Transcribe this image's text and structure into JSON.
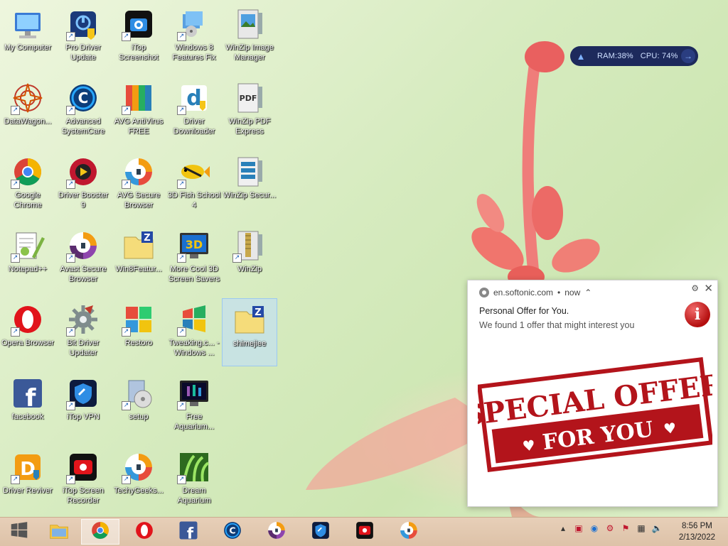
{
  "desktop": {
    "icons": [
      {
        "id": "my-computer",
        "label": "My Computer",
        "icon": "computer-icon",
        "shortcut": false
      },
      {
        "id": "pro-driver-update",
        "label": "Pro Driver Update",
        "icon": "pro-driver-update-icon",
        "shortcut": true
      },
      {
        "id": "itop-screenshot",
        "label": "iTop Screenshot",
        "icon": "camera-icon",
        "shortcut": true
      },
      {
        "id": "windows8-features-fix",
        "label": "Windows 8 Features Fix",
        "icon": "installer-icon",
        "shortcut": true
      },
      {
        "id": "winzip-image-manager",
        "label": "WinZip Image Manager",
        "icon": "winzip-image-icon",
        "shortcut": false
      },
      {
        "id": "datawagon",
        "label": "DataWagon...",
        "icon": "mandala-icon",
        "shortcut": true
      },
      {
        "id": "advanced-systemcare",
        "label": "Advanced SystemCare",
        "icon": "systemcare-icon",
        "shortcut": true
      },
      {
        "id": "avg-antivirus-free",
        "label": "AVG AntiVirus FREE",
        "icon": "avg-icon",
        "shortcut": true
      },
      {
        "id": "driver-downloader",
        "label": "Driver Downloader",
        "icon": "driver-downloader-icon",
        "shortcut": true
      },
      {
        "id": "winzip-pdf-express",
        "label": "WinZip PDF Express",
        "icon": "pdf-icon",
        "shortcut": false
      },
      {
        "id": "google-chrome",
        "label": "Google Chrome",
        "icon": "chrome-icon",
        "shortcut": true
      },
      {
        "id": "driver-booster-9",
        "label": "Driver Booster 9",
        "icon": "driver-booster-icon",
        "shortcut": true
      },
      {
        "id": "avg-secure-browser",
        "label": "AVG Secure Browser",
        "icon": "secure-browser-icon",
        "shortcut": true
      },
      {
        "id": "3d-fish-school-4",
        "label": "3D Fish School 4",
        "icon": "fish-icon",
        "shortcut": true
      },
      {
        "id": "winzip-secure",
        "label": "WinZip Secur...",
        "icon": "winzip-secure-icon",
        "shortcut": false
      },
      {
        "id": "notepad-plus-plus",
        "label": "Notepad++",
        "icon": "notepad-icon",
        "shortcut": true
      },
      {
        "id": "avast-secure-browser",
        "label": "Avast Secure Browser",
        "icon": "avast-browser-icon",
        "shortcut": true
      },
      {
        "id": "win8features",
        "label": "Win8Featur...",
        "icon": "zip-folder-icon",
        "shortcut": false
      },
      {
        "id": "more-cool-3d",
        "label": "More Cool 3D Screen Savers",
        "icon": "monitor-3d-icon",
        "shortcut": true
      },
      {
        "id": "winzip",
        "label": "WinZip",
        "icon": "winzip-icon",
        "shortcut": true
      },
      {
        "id": "opera-browser",
        "label": "Opera Browser",
        "icon": "opera-icon",
        "shortcut": true
      },
      {
        "id": "bit-driver-updater",
        "label": "Bit Driver Updater",
        "icon": "gear-icon",
        "shortcut": true
      },
      {
        "id": "restoro",
        "label": "Restoro",
        "icon": "restoro-icon",
        "shortcut": true
      },
      {
        "id": "tweaking",
        "label": "Tweaking.c... - Windows ...",
        "icon": "windows-flag-icon",
        "shortcut": true
      },
      {
        "id": "shimejiee",
        "label": "shimejiee",
        "icon": "zip-folder-icon",
        "shortcut": false,
        "selected": true
      },
      {
        "id": "facebook",
        "label": "facebook",
        "icon": "facebook-icon",
        "shortcut": false
      },
      {
        "id": "itop-vpn",
        "label": "iTop VPN",
        "icon": "vpn-icon",
        "shortcut": true
      },
      {
        "id": "setup",
        "label": "setup",
        "icon": "setup-icon",
        "shortcut": true
      },
      {
        "id": "free-aquarium",
        "label": "Free Aquarium...",
        "icon": "aquarium-monitor-icon",
        "shortcut": true
      },
      {
        "id": "driver-reviver",
        "label": "Driver Reviver",
        "icon": "driver-reviver-icon",
        "shortcut": true
      },
      {
        "id": "itop-screen-recorder",
        "label": "iTop Screen Recorder",
        "icon": "recorder-icon",
        "shortcut": true
      },
      {
        "id": "techygeeks",
        "label": "TechyGeeks...",
        "icon": "secure-browser-icon",
        "shortcut": true
      },
      {
        "id": "dream-aquarium",
        "label": "Dream Aquarium",
        "icon": "plant-icon",
        "shortcut": true
      }
    ]
  },
  "perf_widget": {
    "ram": "RAM:38%",
    "cpu": "CPU: 74%"
  },
  "notification": {
    "source": "en.softonic.com",
    "time": "now",
    "title": "Personal Offer for You.",
    "body": "We found 1 offer that might interest you",
    "stamp_line1": "SPECIAL OFFER",
    "stamp_line2": "FOR YOU",
    "stamp_color": "#b3141b"
  },
  "taskbar": {
    "apps": [
      {
        "name": "start-button",
        "icon": "windows-logo-icon"
      },
      {
        "name": "file-explorer",
        "icon": "folder-icon"
      },
      {
        "name": "chrome",
        "icon": "chrome-icon",
        "active": true
      },
      {
        "name": "opera",
        "icon": "opera-icon"
      },
      {
        "name": "facebook",
        "icon": "facebook-icon"
      },
      {
        "name": "advanced-systemcare",
        "icon": "systemcare-icon"
      },
      {
        "name": "avast-secure-browser",
        "icon": "avast-browser-icon"
      },
      {
        "name": "itop-vpn",
        "icon": "vpn-icon"
      },
      {
        "name": "itop-screen-recorder",
        "icon": "recorder-icon"
      },
      {
        "name": "avg-secure-browser",
        "icon": "secure-browser-icon"
      }
    ],
    "clock": {
      "time": "8:56 PM",
      "date": "2/13/2022"
    }
  }
}
